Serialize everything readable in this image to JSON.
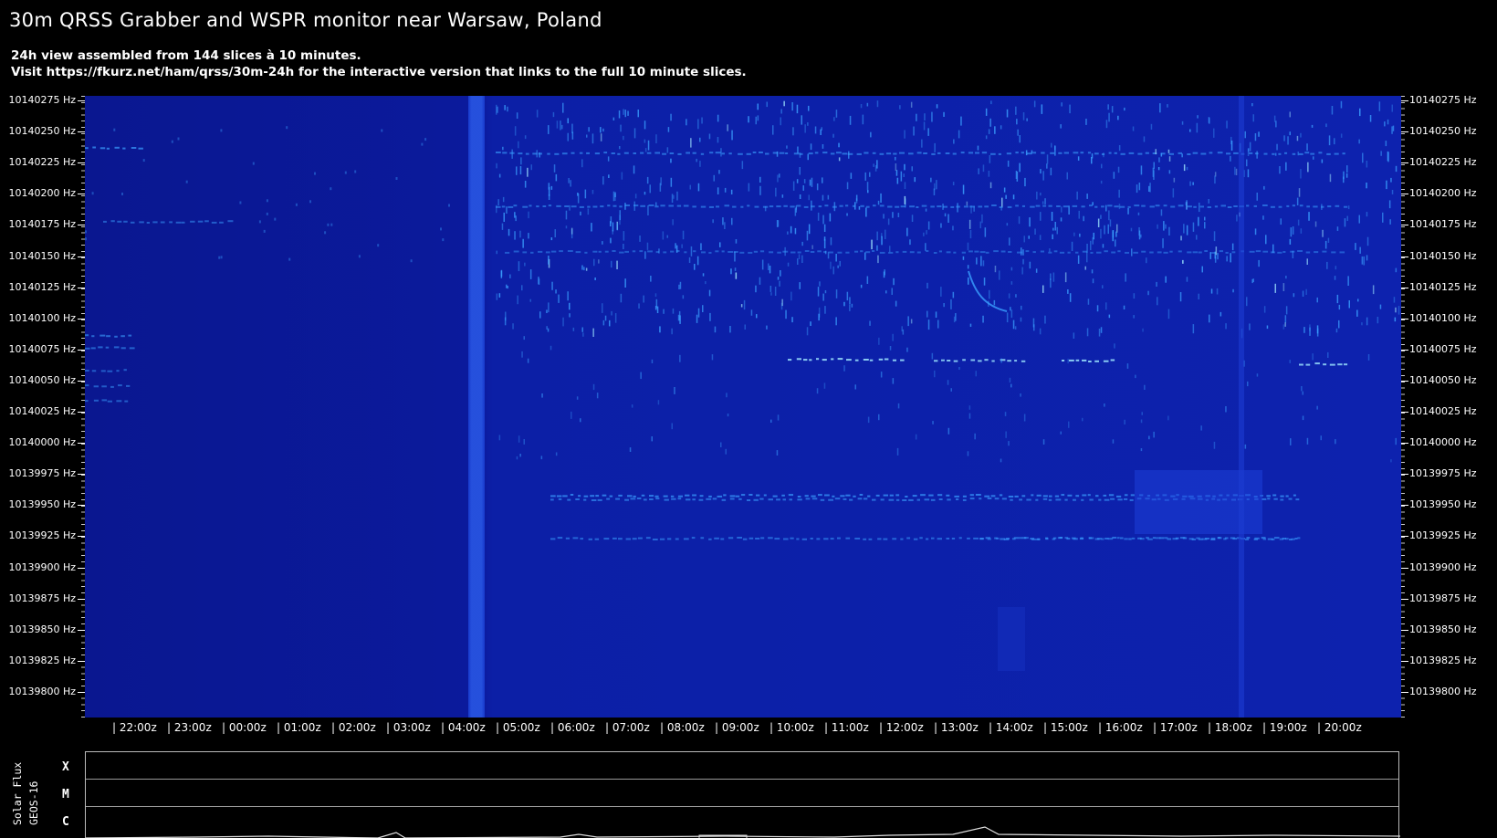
{
  "header": {
    "title": "30m QRSS Grabber and WSPR monitor near Warsaw, Poland",
    "line1": "24h view assembled from 144 slices à 10 minutes.",
    "line2": "Visit https://fkurz.net/ham/qrss/30m-24h for the interactive version that links to the full 10 minute slices."
  },
  "frequency_axis": {
    "labels": [
      "10140275 Hz",
      "10140250 Hz",
      "10140225 Hz",
      "10140200 Hz",
      "10140175 Hz",
      "10140150 Hz",
      "10140125 Hz",
      "10140100 Hz",
      "10140075 Hz",
      "10140050 Hz",
      "10140025 Hz",
      "10140000 Hz",
      "10139975 Hz",
      "10139950 Hz",
      "10139925 Hz",
      "10139900 Hz",
      "10139875 Hz",
      "10139850 Hz",
      "10139825 Hz",
      "10139800 Hz"
    ]
  },
  "time_axis": {
    "labels": [
      "| 22:00z",
      "| 23:00z",
      "| 00:00z",
      "| 01:00z",
      "| 02:00z",
      "| 03:00z",
      "| 04:00z",
      "| 05:00z",
      "| 06:00z",
      "| 07:00z",
      "| 08:00z",
      "| 09:00z",
      "| 10:00z",
      "| 11:00z",
      "| 12:00z",
      "| 13:00z",
      "| 14:00z",
      "| 15:00z",
      "| 16:00z",
      "| 17:00z",
      "| 18:00z",
      "| 19:00z",
      "| 20:00z"
    ]
  },
  "solar_flux": {
    "label_line1": "Solar Flux",
    "label_line2": "GEOS-16",
    "classes": [
      "X",
      "M",
      "C"
    ]
  },
  "colors": {
    "waterfall_background": "#0b1ba0",
    "signal_color": "#3aa0ff",
    "strong_signal_color": "#9fe8ff",
    "axis_text": "#ffffff"
  }
}
